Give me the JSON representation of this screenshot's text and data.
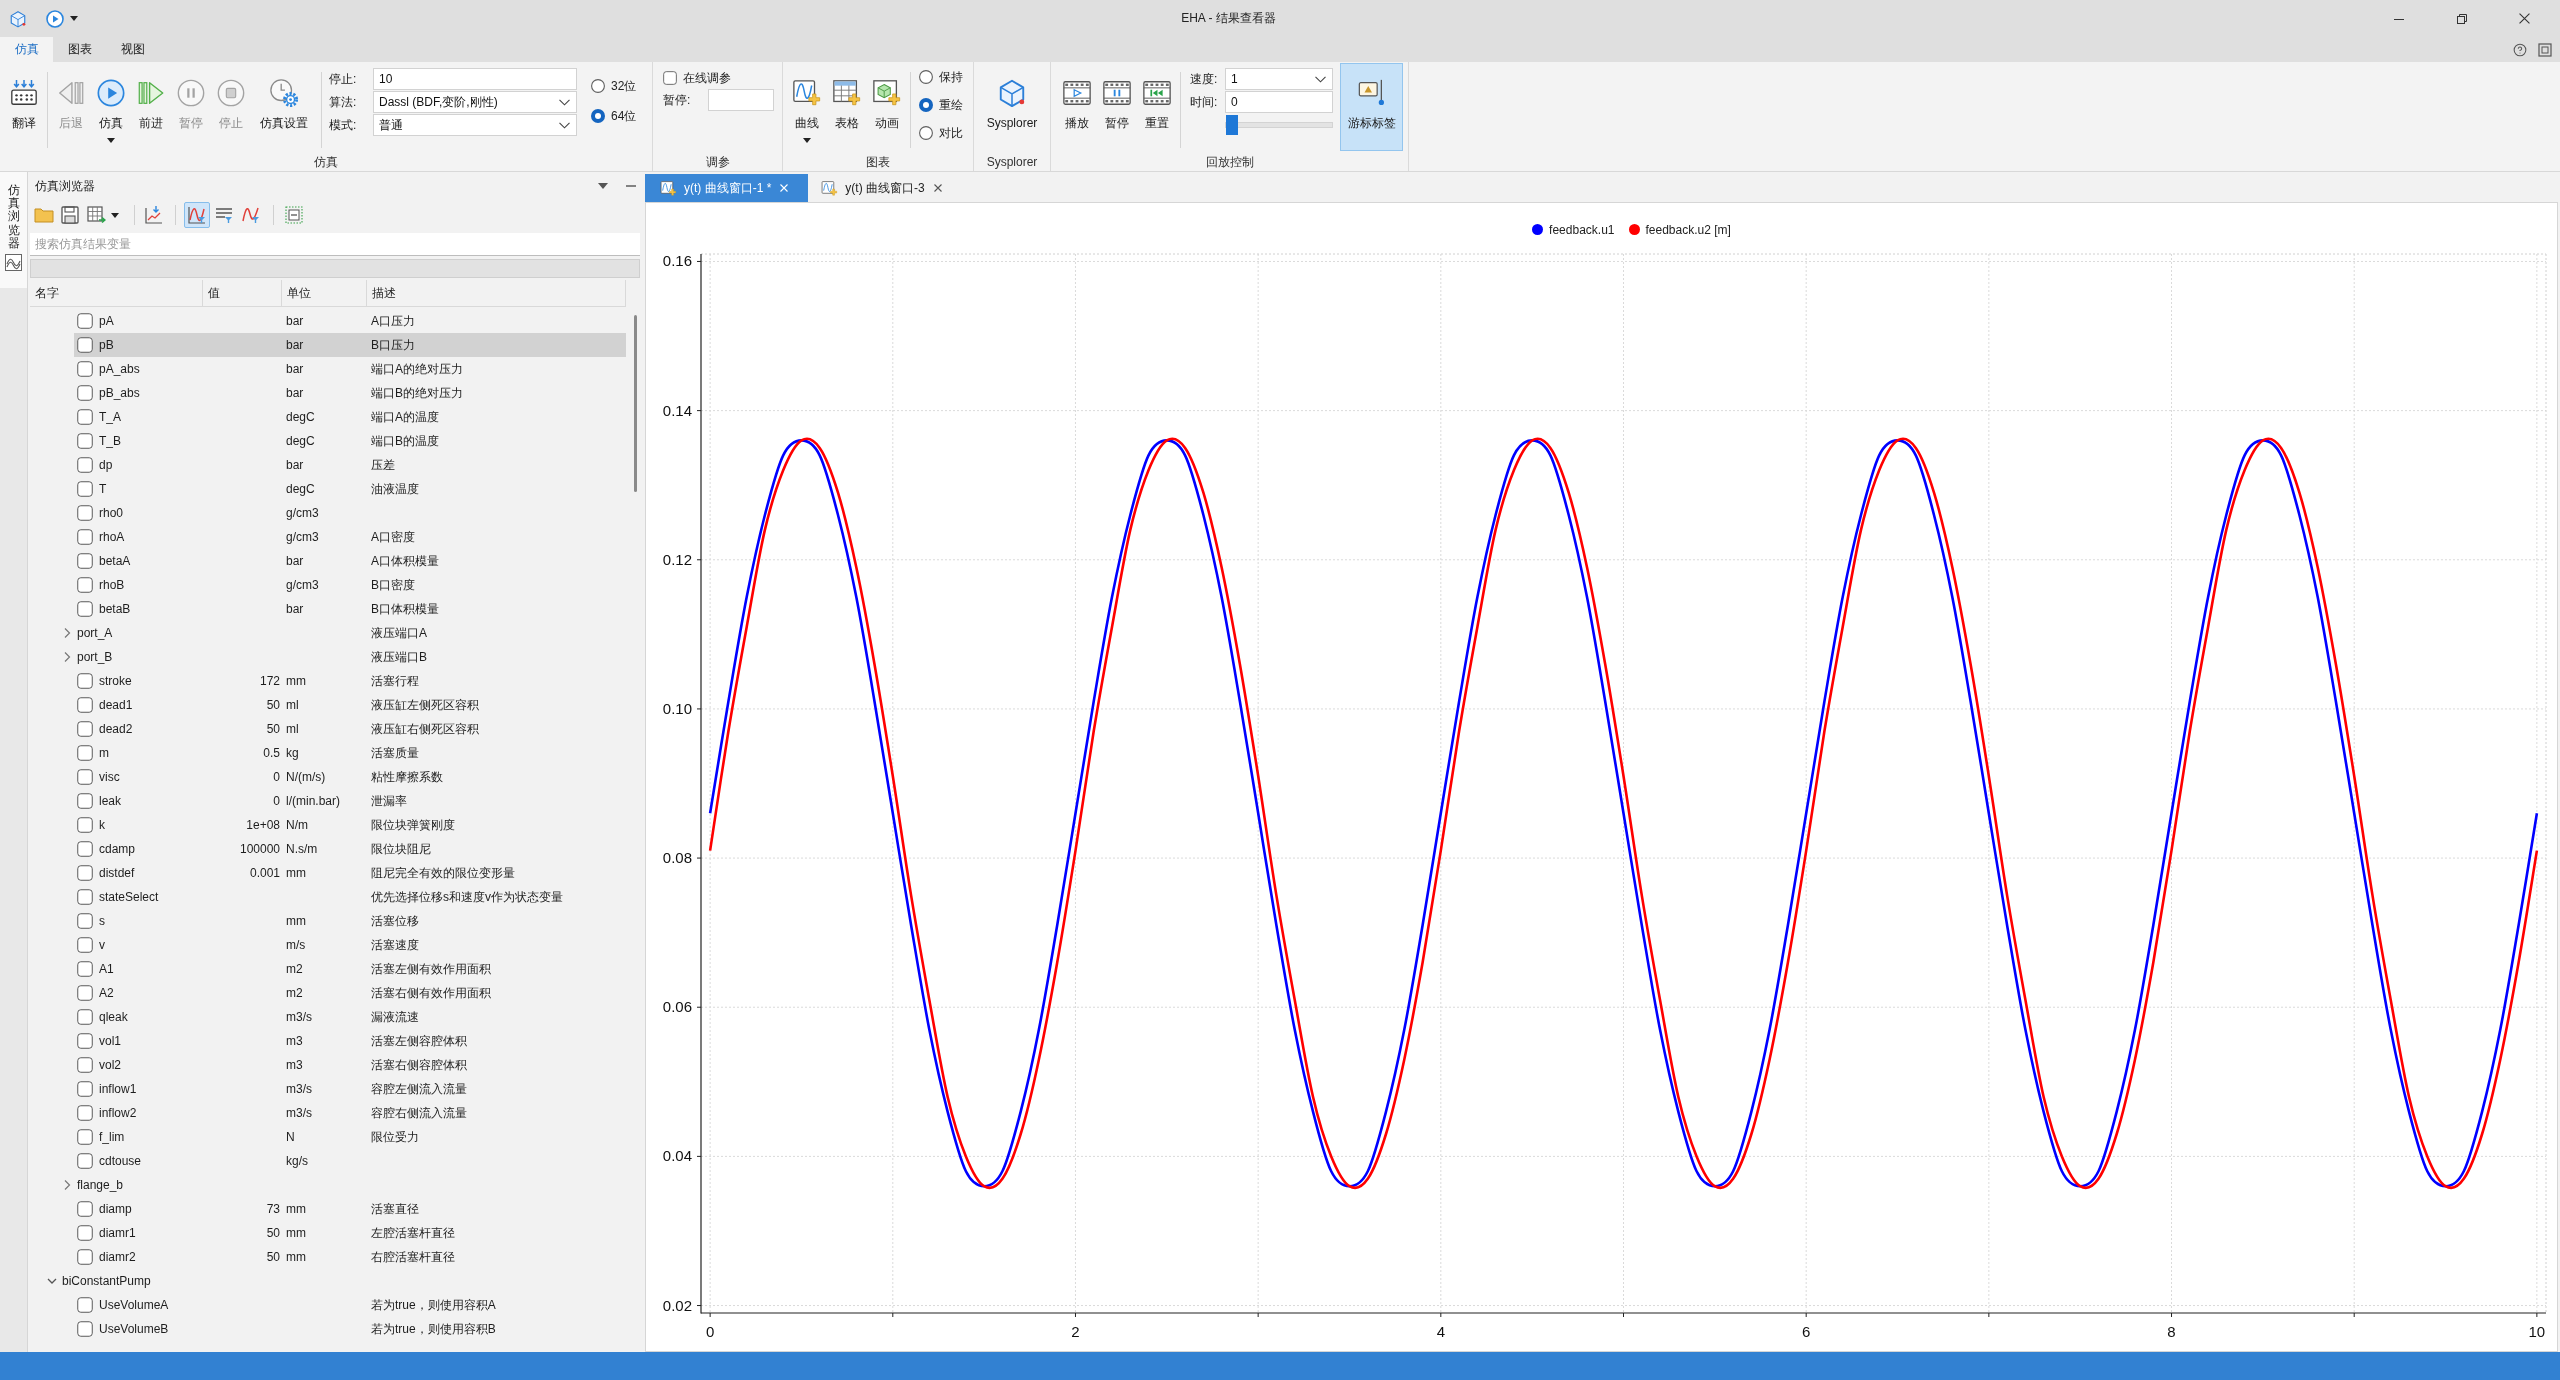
{
  "window": {
    "title": "EHA - 结果查看器"
  },
  "menu_tabs": [
    {
      "label": "仿真",
      "selected": true
    },
    {
      "label": "图表",
      "selected": false
    },
    {
      "label": "视图",
      "selected": false
    }
  ],
  "ribbon": {
    "simulation_group": {
      "title": "仿真",
      "buttons": [
        {
          "label": "翻译",
          "disabled": false,
          "has_menu": false
        },
        {
          "label": "后退",
          "disabled": true,
          "has_menu": false
        },
        {
          "label": "仿真",
          "disabled": false,
          "has_menu": true
        },
        {
          "label": "前进",
          "disabled": false,
          "has_menu": false
        },
        {
          "label": "暂停",
          "disabled": true,
          "has_menu": false
        },
        {
          "label": "停止",
          "disabled": true,
          "has_menu": false
        },
        {
          "label": "仿真设置",
          "disabled": false,
          "has_menu": false
        }
      ],
      "fields": [
        {
          "kind": "input",
          "label": "停止:",
          "value": "10"
        },
        {
          "kind": "combo",
          "label": "算法:",
          "value": "Dassl (BDF,变阶,刚性)"
        },
        {
          "kind": "combo",
          "label": "模式:",
          "value": "普通"
        }
      ],
      "precision": [
        {
          "label": "32位",
          "selected": false
        },
        {
          "label": "64位",
          "selected": true
        }
      ]
    },
    "tuning_group": {
      "title": "调参",
      "online_tuning": {
        "label": "在线调参",
        "checked": false
      },
      "pause_field": {
        "label": "暂停:"
      }
    },
    "chart_group": {
      "title": "图表",
      "buttons": [
        {
          "label": "曲线",
          "has_menu": true
        },
        {
          "label": "表格",
          "has_menu": false
        },
        {
          "label": "动画",
          "has_menu": false
        }
      ],
      "modes": [
        {
          "label": "保持",
          "selected": false
        },
        {
          "label": "重绘",
          "selected": true
        },
        {
          "label": "对比",
          "selected": false
        }
      ]
    },
    "sysplorer_group": {
      "title": "Sysplorer",
      "button": {
        "label": "Sysplorer"
      }
    },
    "playback_group": {
      "title": "回放控制",
      "buttons": [
        {
          "label": "播放"
        },
        {
          "label": "暂停"
        },
        {
          "label": "重置"
        }
      ],
      "speed": {
        "label": "速度:",
        "value": "1"
      },
      "time": {
        "label": "时间:",
        "value": "0"
      },
      "time_slider": {
        "level": 0
      },
      "cursor_label": {
        "label": "游标标签",
        "on": true
      }
    }
  },
  "side_bar": {
    "tab": "仿真浏览器"
  },
  "browser": {
    "title": "仿真浏览器",
    "toolbar_toggles": [
      {
        "on": true
      },
      {
        "on": false
      },
      {
        "on": false
      }
    ],
    "search": {
      "placeholder": "搜索仿真结果变量"
    },
    "columns": [
      "名字",
      "值",
      "单位",
      "描述"
    ],
    "rows_continued": [
      {
        "kind": "variable",
        "name": "pA",
        "unit": "bar",
        "description": "A口压力",
        "checked": false,
        "selected": false
      },
      {
        "kind": "variable",
        "name": "pB",
        "unit": "bar",
        "description": "B口压力",
        "checked": false,
        "selected": true
      },
      {
        "kind": "variable",
        "name": "pA_abs",
        "unit": "bar",
        "description": "端口A的绝对压力",
        "checked": false,
        "selected": false
      },
      {
        "kind": "variable",
        "name": "pB_abs",
        "unit": "bar",
        "description": "端口B的绝对压力",
        "checked": false,
        "selected": false
      },
      {
        "kind": "variable",
        "name": "T_A",
        "unit": "degC",
        "description": "端口A的温度",
        "checked": false,
        "selected": false
      },
      {
        "kind": "variable",
        "name": "T_B",
        "unit": "degC",
        "description": "端口B的温度",
        "checked": false,
        "selected": false
      },
      {
        "kind": "variable",
        "name": "dp",
        "unit": "bar",
        "description": "压差",
        "checked": false,
        "selected": false
      },
      {
        "kind": "variable",
        "name": "T",
        "unit": "degC",
        "description": "油液温度",
        "checked": false,
        "selected": false
      },
      {
        "kind": "variable",
        "name": "rho0",
        "unit": "g/cm3",
        "checked": false,
        "selected": false
      },
      {
        "kind": "variable",
        "name": "rhoA",
        "unit": "g/cm3",
        "description": "A口密度",
        "checked": false,
        "selected": false
      },
      {
        "kind": "variable",
        "name": "betaA",
        "unit": "bar",
        "description": "A口体积模量",
        "checked": false,
        "selected": false
      },
      {
        "kind": "variable",
        "name": "rhoB",
        "unit": "g/cm3",
        "description": "B口密度",
        "checked": false,
        "selected": false
      },
      {
        "kind": "variable",
        "name": "betaB",
        "unit": "bar",
        "description": "B口体积模量",
        "checked": false,
        "selected": false
      },
      {
        "kind": "group",
        "name": "port_A",
        "description": "液压端口A",
        "expanded": false,
        "selected": false
      },
      {
        "kind": "group",
        "name": "port_B",
        "description": "液压端口B",
        "expanded": false,
        "selected": false
      },
      {
        "kind": "variable",
        "name": "stroke",
        "value": "172",
        "unit": "mm",
        "description": "活塞行程",
        "checked": false,
        "selected": false
      },
      {
        "kind": "variable",
        "name": "dead1",
        "value": "50",
        "unit": "ml",
        "description": "液压缸左侧死区容积",
        "checked": false,
        "selected": false
      },
      {
        "kind": "variable",
        "name": "dead2",
        "value": "50",
        "unit": "ml",
        "description": "液压缸右侧死区容积",
        "checked": false,
        "selected": false
      },
      {
        "kind": "variable",
        "name": "m",
        "value": "0.5",
        "unit": "kg",
        "description": "活塞质量",
        "checked": false,
        "selected": false
      },
      {
        "kind": "variable",
        "name": "visc",
        "value": "0",
        "unit": "N/(m/s)",
        "description": "粘性摩擦系数",
        "checked": false,
        "selected": false
      },
      {
        "kind": "variable",
        "name": "leak",
        "value": "0",
        "unit": "l/(min.bar)",
        "description": "泄漏率",
        "checked": false,
        "selected": false
      },
      {
        "kind": "variable",
        "name": "k",
        "value": "1e+08",
        "unit": "N/m",
        "description": "限位块弹簧刚度",
        "checked": false,
        "selected": false
      },
      {
        "kind": "variable",
        "name": "cdamp",
        "value": "100000",
        "unit": "N.s/m",
        "description": "限位块阻尼",
        "checked": false,
        "selected": false
      },
      {
        "kind": "variable",
        "name": "distdef",
        "value": "0.001",
        "unit": "mm",
        "description": "阻尼完全有效的限位变形量",
        "checked": false,
        "selected": false
      },
      {
        "kind": "variable",
        "name": "stateSelect",
        "description": "优先选择位移s和速度v作为状态变量",
        "checked": false,
        "selected": false
      },
      {
        "kind": "variable",
        "name": "s",
        "unit": "mm",
        "description": "活塞位移",
        "checked": false,
        "selected": false
      },
      {
        "kind": "variable",
        "name": "v",
        "unit": "m/s",
        "description": "活塞速度",
        "checked": false,
        "selected": false
      },
      {
        "kind": "variable",
        "name": "A1",
        "unit": "m2",
        "description": "活塞左侧有效作用面积",
        "checked": false,
        "selected": false
      },
      {
        "kind": "variable",
        "name": "A2",
        "unit": "m2",
        "description": "活塞右侧有效作用面积",
        "checked": false,
        "selected": false
      },
      {
        "kind": "variable",
        "name": "qleak",
        "unit": "m3/s",
        "description": "漏液流速",
        "checked": false,
        "selected": false
      },
      {
        "kind": "variable",
        "name": "vol1",
        "unit": "m3",
        "description": "活塞左侧容腔体积",
        "checked": false,
        "selected": false
      },
      {
        "kind": "variable",
        "name": "vol2",
        "unit": "m3",
        "description": "活塞右侧容腔体积",
        "checked": false,
        "selected": false
      },
      {
        "kind": "variable",
        "name": "inflow1",
        "unit": "m3/s",
        "description": "容腔左侧流入流量",
        "checked": false,
        "selected": false
      },
      {
        "kind": "variable",
        "name": "inflow2",
        "unit": "m3/s",
        "description": "容腔右侧流入流量",
        "checked": false,
        "selected": false
      },
      {
        "kind": "variable",
        "name": "f_lim",
        "unit": "N",
        "description": "限位受力",
        "checked": false,
        "selected": false
      },
      {
        "kind": "variable",
        "name": "cdtouse",
        "unit": "kg/s",
        "checked": false,
        "selected": false
      },
      {
        "kind": "group",
        "name": "flange_b",
        "expanded": false,
        "selected": false
      },
      {
        "kind": "variable",
        "name": "diamp",
        "value": "73",
        "unit": "mm",
        "description": "活塞直径",
        "checked": false,
        "selected": false
      },
      {
        "kind": "variable",
        "name": "diamr1",
        "value": "50",
        "unit": "mm",
        "description": "左腔活塞杆直径",
        "checked": false,
        "selected": false
      },
      {
        "kind": "variable",
        "name": "diamr2",
        "value": "50",
        "unit": "mm",
        "description": "右腔活塞杆直径",
        "checked": false,
        "selected": false
      }
    ],
    "rows": [
      {
        "kind": "group",
        "name": "biConstantPump",
        "expanded": true,
        "selected": false,
        "children": [
          {
            "kind": "variable",
            "name": "UseVolumeA",
            "description": "若为true，则使用容积A",
            "checked": false,
            "selected": false
          },
          {
            "kind": "variable",
            "name": "UseVolumeB",
            "description": "若为true，则使用容积B",
            "checked": false,
            "selected": false
          }
        ]
      }
    ]
  },
  "plot_window": {
    "tabs": [
      {
        "label": "y(t) 曲线窗口-1 *",
        "selected": true
      },
      {
        "label": "y(t) 曲线窗口-3",
        "selected": false
      }
    ],
    "chart_data": {
      "type": "line",
      "x": [
        0,
        0.1,
        0.2,
        0.3,
        0.4,
        0.5,
        0.6,
        0.7,
        0.8,
        0.9,
        1,
        1.1,
        1.2,
        1.3,
        1.4,
        1.5,
        1.6,
        1.7,
        1.8,
        1.9,
        2,
        2.1,
        2.2,
        2.3,
        2.4,
        2.5,
        2.6,
        2.7,
        2.8,
        2.9,
        3,
        3.1,
        3.2,
        3.3,
        3.4,
        3.5,
        3.6,
        3.7,
        3.8,
        3.9,
        4,
        4.1,
        4.2,
        4.3,
        4.4,
        4.5,
        4.6,
        4.7,
        4.8,
        4.9,
        5,
        5.1,
        5.2,
        5.3,
        5.4,
        5.5,
        5.6,
        5.7,
        5.8,
        5.9,
        6,
        6.1,
        6.2,
        6.3,
        6.4,
        6.5,
        6.6,
        6.7,
        6.8,
        6.9,
        7,
        7.1,
        7.2,
        7.3,
        7.4,
        7.5,
        7.6,
        7.7,
        7.8,
        7.9,
        8,
        8.1,
        8.2,
        8.3,
        8.4,
        8.5,
        8.6,
        8.7,
        8.8,
        8.9,
        9,
        9.1,
        9.2,
        9.3,
        9.4,
        9.5,
        9.6,
        9.7,
        9.8,
        9.9,
        10
      ],
      "series": [
        {
          "name": "feedback.u1",
          "color": "#0000ff",
          "values": [
            0.086,
            0.101,
            0.115,
            0.126,
            0.134,
            0.136,
            0.134,
            0.126,
            0.115,
            0.101,
            0.086,
            0.071,
            0.057,
            0.046,
            0.038,
            0.036,
            0.038,
            0.046,
            0.057,
            0.071,
            0.086,
            0.101,
            0.115,
            0.126,
            0.134,
            0.136,
            0.134,
            0.126,
            0.115,
            0.101,
            0.086,
            0.071,
            0.057,
            0.046,
            0.038,
            0.036,
            0.038,
            0.046,
            0.057,
            0.071,
            0.086,
            0.101,
            0.115,
            0.126,
            0.134,
            0.136,
            0.134,
            0.126,
            0.115,
            0.101,
            0.086,
            0.071,
            0.057,
            0.046,
            0.038,
            0.036,
            0.038,
            0.046,
            0.057,
            0.071,
            0.086,
            0.101,
            0.115,
            0.126,
            0.134,
            0.136,
            0.134,
            0.126,
            0.115,
            0.101,
            0.086,
            0.071,
            0.057,
            0.046,
            0.038,
            0.036,
            0.038,
            0.046,
            0.057,
            0.071,
            0.086,
            0.101,
            0.115,
            0.126,
            0.134,
            0.136,
            0.134,
            0.126,
            0.115,
            0.101,
            0.086,
            0.071,
            0.057,
            0.046,
            0.038,
            0.036,
            0.038,
            0.046,
            0.057,
            0.071,
            0.086
          ]
        },
        {
          "name": "feedback.u2 [m]",
          "color": "#ff0000",
          "values": [
            0.081,
            0.097,
            0.111,
            0.124,
            0.132,
            0.136,
            0.135,
            0.129,
            0.119,
            0.106,
            0.091,
            0.075,
            0.061,
            0.048,
            0.04,
            0.036,
            0.037,
            0.043,
            0.053,
            0.066,
            0.081,
            0.097,
            0.111,
            0.124,
            0.132,
            0.136,
            0.135,
            0.129,
            0.119,
            0.106,
            0.091,
            0.075,
            0.061,
            0.048,
            0.04,
            0.036,
            0.037,
            0.043,
            0.053,
            0.066,
            0.081,
            0.097,
            0.111,
            0.124,
            0.132,
            0.136,
            0.135,
            0.129,
            0.119,
            0.106,
            0.091,
            0.075,
            0.061,
            0.048,
            0.04,
            0.036,
            0.037,
            0.043,
            0.053,
            0.066,
            0.081,
            0.097,
            0.111,
            0.124,
            0.132,
            0.136,
            0.135,
            0.129,
            0.119,
            0.106,
            0.091,
            0.075,
            0.061,
            0.048,
            0.04,
            0.036,
            0.037,
            0.043,
            0.053,
            0.066,
            0.081,
            0.097,
            0.111,
            0.124,
            0.132,
            0.136,
            0.135,
            0.129,
            0.119,
            0.106,
            0.091,
            0.075,
            0.061,
            0.048,
            0.04,
            0.036,
            0.037,
            0.043,
            0.053,
            0.066,
            0.081
          ]
        }
      ],
      "xlim": [
        -0.05,
        10.05
      ],
      "ylim": [
        0.019,
        0.161
      ],
      "xticks": [
        0,
        2,
        4,
        6,
        8,
        10
      ],
      "yticks": [
        0.02,
        0.04,
        0.06,
        0.08,
        {
          "value": 0.1,
          "label": "0.10"
        },
        0.12,
        0.14,
        0.16
      ],
      "grid": true
    }
  }
}
